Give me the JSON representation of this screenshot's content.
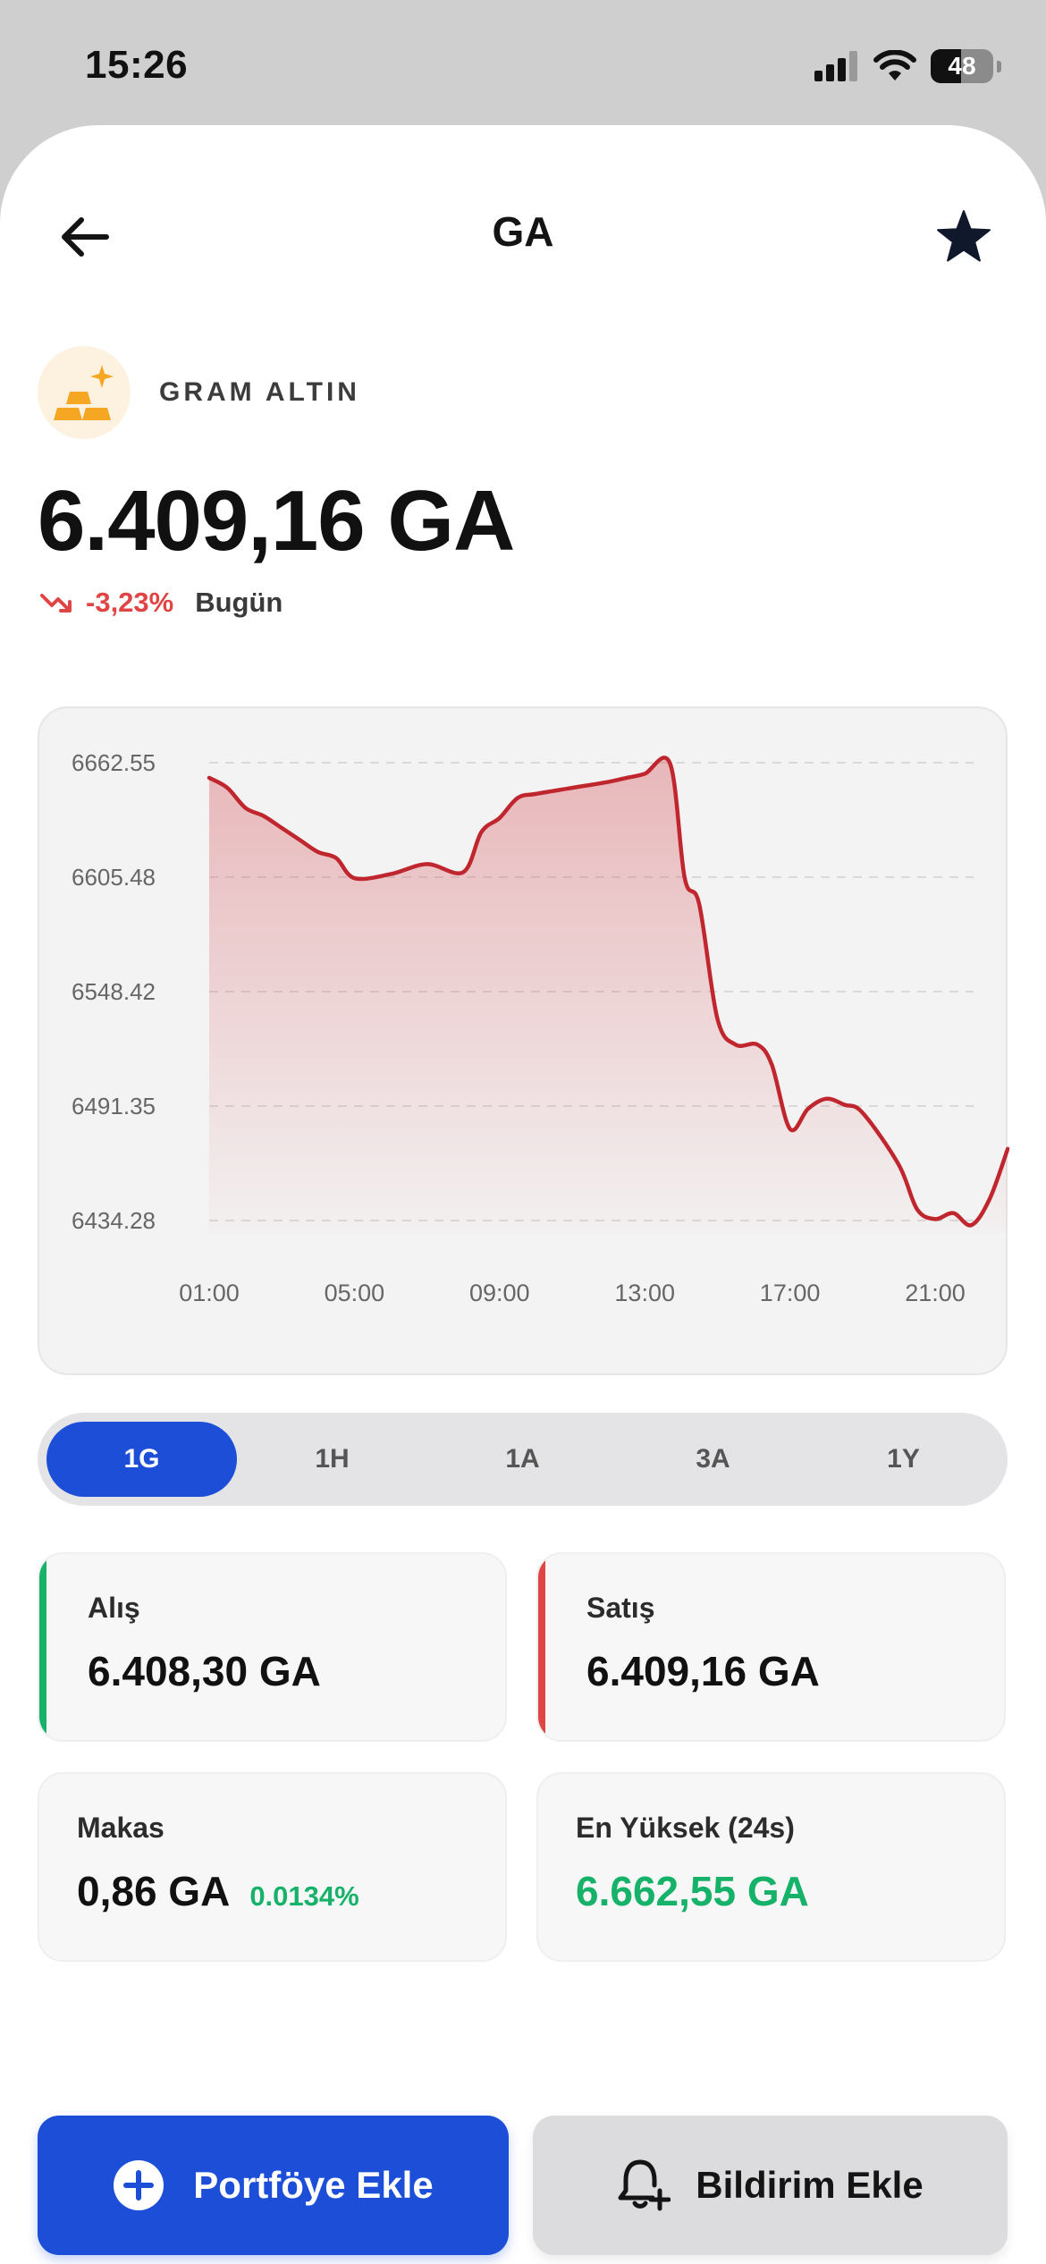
{
  "status_bar": {
    "time": "15:26",
    "battery": "48"
  },
  "header": {
    "title": "GA"
  },
  "asset": {
    "name": "GRAM ALTIN",
    "price": "6.409,16 GA",
    "change": "-3,23%",
    "period": "Bugün"
  },
  "colors": {
    "accent": "#1c4ed8",
    "down": "#e04545",
    "up": "#17b26a",
    "line": "#c0262d",
    "gold": "#f5a623"
  },
  "chart_data": {
    "type": "area",
    "y_ticks": [
      "6662.55",
      "6605.48",
      "6548.42",
      "6491.35",
      "6434.28"
    ],
    "x_ticks": [
      "01:00",
      "05:00",
      "09:00",
      "13:00",
      "17:00",
      "21:00"
    ],
    "ylim": [
      6434.28,
      6662.55
    ],
    "x_hours": [
      1.0,
      1.5,
      2.0,
      2.5,
      3.0,
      3.5,
      4.0,
      4.5,
      5.0,
      6.0,
      7.0,
      8.0,
      8.5,
      9.0,
      9.5,
      10.0,
      11.0,
      12.0,
      12.5,
      13.0,
      13.7,
      14.1,
      14.5,
      15.0,
      15.5,
      16.1,
      16.5,
      17.0,
      17.5,
      18.0,
      18.5,
      19.0,
      20.0,
      20.5,
      21.0,
      21.5,
      22.0,
      22.5,
      23.0
    ],
    "values": [
      6655,
      6650,
      6640,
      6636,
      6630,
      6624,
      6618,
      6615,
      6605,
      6607,
      6612,
      6608,
      6628,
      6635,
      6645,
      6647,
      6650,
      6653,
      6655,
      6657,
      6662,
      6605,
      6592,
      6535,
      6522,
      6522,
      6512,
      6480,
      6490,
      6495,
      6492,
      6488,
      6462,
      6440,
      6435,
      6438,
      6432,
      6445,
      6470
    ],
    "grid": true,
    "gridline_style": "dashed"
  },
  "ranges": [
    "1G",
    "1H",
    "1A",
    "3A",
    "1Y"
  ],
  "active_range": "1G",
  "stats": {
    "bid": {
      "label": "Alış",
      "value": "6.408,30 GA"
    },
    "ask": {
      "label": "Satış",
      "value": "6.409,16 GA"
    },
    "spread": {
      "label": "Makas",
      "value": "0,86 GA",
      "pct": "0.0134%"
    },
    "high": {
      "label": "En Yüksek (24s)",
      "value": "6.662,55 GA"
    }
  },
  "actions": {
    "portfolio": "Portföye Ekle",
    "alert": "Bildirim Ekle"
  }
}
